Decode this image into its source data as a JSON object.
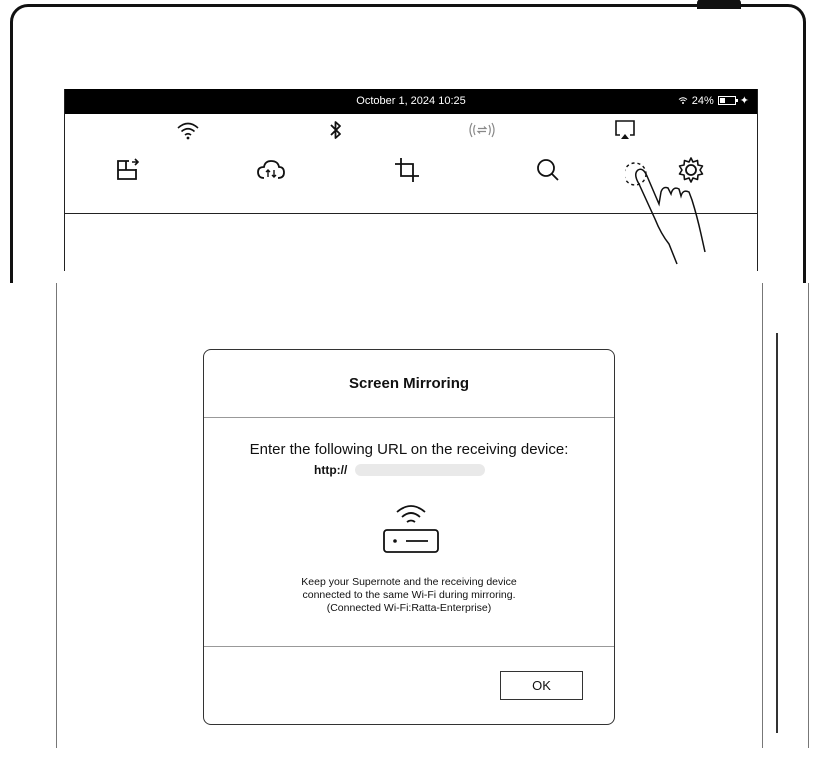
{
  "status_bar": {
    "datetime": "October 1, 2024  10:25",
    "battery": "24%"
  },
  "quick_settings": {
    "row1": [
      "wifi-icon",
      "bluetooth-icon",
      "wireless-transfer-icon",
      "screen-mirroring-icon"
    ],
    "row2": [
      "export-icon",
      "cloud-sync-icon",
      "crop-icon",
      "search-icon",
      "settings-icon"
    ]
  },
  "dialog": {
    "title": "Screen Mirroring",
    "prompt": "Enter the following URL on the receiving device:",
    "url_prefix": "http://",
    "note_line1": "Keep your Supernote and the receiving device",
    "note_line2": "connected to the same Wi-Fi during mirroring.",
    "note_line3": "(Connected Wi-Fi:Ratta-Enterprise)",
    "ok_label": "OK"
  }
}
